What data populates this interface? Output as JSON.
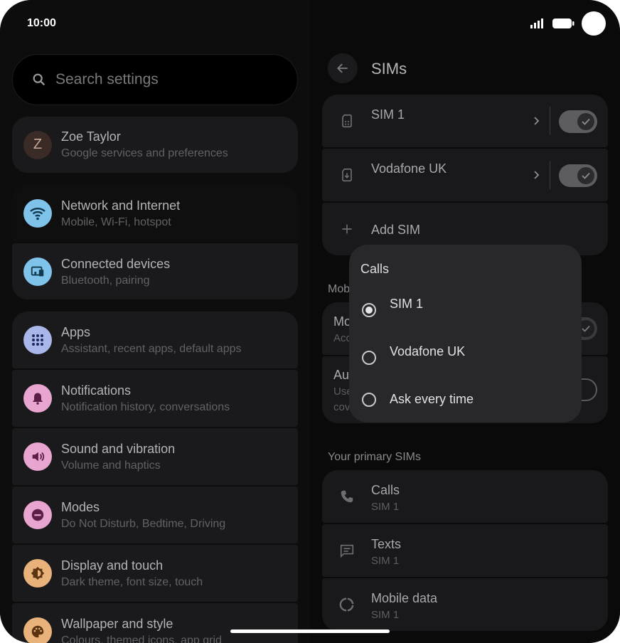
{
  "status": {
    "time": "10:00"
  },
  "search": {
    "placeholder": "Search settings"
  },
  "account": {
    "initial": "Z",
    "name": "Zoe Taylor",
    "subtitle": "Google services and preferences"
  },
  "settings": [
    {
      "title": "Network and Internet",
      "subtitle": "Mobile, Wi-Fi, hotspot",
      "icon": "wifi-icon",
      "color": "#7fc3ea"
    },
    {
      "title": "Connected devices",
      "subtitle": "Bluetooth, pairing",
      "icon": "devices-icon",
      "color": "#7fc3ea"
    },
    {
      "title": "Apps",
      "subtitle": "Assistant, recent apps, default apps",
      "icon": "apps-grid-icon",
      "color": "#a9b6e9"
    },
    {
      "title": "Notifications",
      "subtitle": "Notification history, conversations",
      "icon": "bell-icon",
      "color": "#e8a5cf"
    },
    {
      "title": "Sound and vibration",
      "subtitle": "Volume and haptics",
      "icon": "volume-icon",
      "color": "#e8a5cf"
    },
    {
      "title": "Modes",
      "subtitle": "Do Not Disturb, Bedtime, Driving",
      "icon": "do-not-disturb-icon",
      "color": "#e8a5cf"
    },
    {
      "title": "Display and touch",
      "subtitle": "Dark theme, font size, touch",
      "icon": "brightness-icon",
      "color": "#e9b27a"
    },
    {
      "title": "Wallpaper and style",
      "subtitle": "Colours, themed icons, app grid",
      "icon": "palette-icon",
      "color": "#e9b27a"
    }
  ],
  "sims_page": {
    "title": "SIMs",
    "sims": [
      {
        "name": "SIM 1",
        "enabled": true
      },
      {
        "name": "Vodafone UK",
        "enabled": true
      }
    ],
    "add_sim": "Add SIM",
    "mobile_section_partial": "Mob",
    "mobile_rows_partial": [
      {
        "title": "Mo",
        "subtitle": "Acc"
      },
      {
        "title": "Au",
        "subtitle": "Use",
        "subtitle2": "cov"
      }
    ],
    "primary_section": "Your primary SIMs",
    "primary": [
      {
        "title": "Calls",
        "subtitle": "SIM 1"
      },
      {
        "title": "Texts",
        "subtitle": "SIM 1"
      },
      {
        "title": "Mobile data",
        "subtitle": "SIM 1"
      }
    ]
  },
  "dialog": {
    "title": "Calls",
    "options": [
      {
        "label": "SIM 1",
        "selected": true
      },
      {
        "label": "Vodafone UK",
        "selected": false
      },
      {
        "label": "Ask every time",
        "selected": false
      }
    ]
  }
}
